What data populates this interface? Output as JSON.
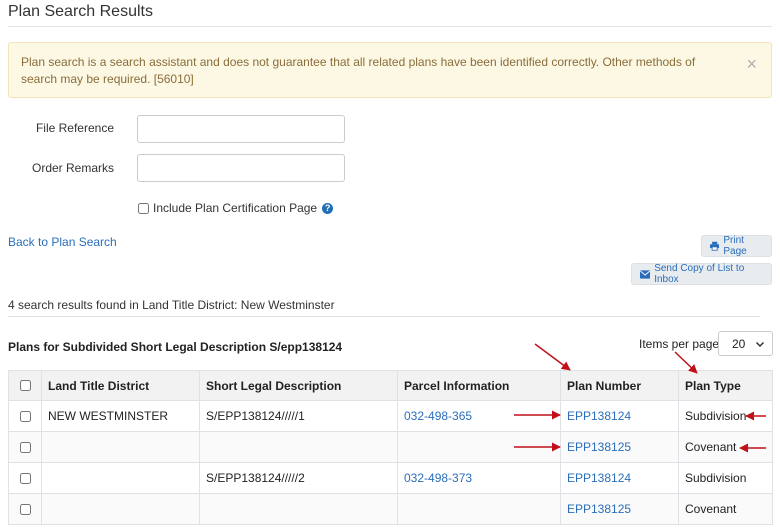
{
  "page": {
    "title": "Plan Search Results"
  },
  "alert": {
    "message": "Plan search is a search assistant and does not guarantee that all related plans have been identified correctly. Other methods of search may be required. [56010]",
    "close_symbol": "×"
  },
  "form": {
    "file_reference_label": "File Reference",
    "file_reference_value": "",
    "order_remarks_label": "Order Remarks",
    "order_remarks_value": "",
    "certification_label": "Include Plan Certification Page",
    "certification_checked": false
  },
  "actions": {
    "back_link": "Back to Plan Search",
    "print_label": "Print Page",
    "send_label": "Send Copy of List to Inbox"
  },
  "results": {
    "summary": "4 search results found in Land Title District: New Westminster",
    "table_title": "Plans for Subdivided Short Legal Description S/epp138124",
    "items_per_page_label": "Items per page",
    "items_per_page_value": "20",
    "columns": [
      "Land Title District",
      "Short Legal Description",
      "Parcel Information",
      "Plan Number",
      "Plan Type"
    ],
    "rows": [
      {
        "district": "NEW WESTMINSTER",
        "short_legal": "S/EPP138124/////1",
        "parcel": "032-498-365",
        "plan_number": "EPP138124",
        "plan_type": "Subdivision"
      },
      {
        "district": "",
        "short_legal": "",
        "parcel": "",
        "plan_number": "EPP138125",
        "plan_type": "Covenant"
      },
      {
        "district": "",
        "short_legal": "S/EPP138124/////2",
        "parcel": "032-498-373",
        "plan_number": "EPP138124",
        "plan_type": "Subdivision"
      },
      {
        "district": "",
        "short_legal": "",
        "parcel": "",
        "plan_number": "EPP138125",
        "plan_type": "Covenant"
      }
    ]
  },
  "colors": {
    "link": "#2a6ebb",
    "alert_bg": "#fcf8e3",
    "alert_text": "#8a6d3b",
    "annotation_arrow": "#c0101a"
  },
  "icons": [
    "close-icon",
    "help-icon",
    "printer-icon",
    "envelope-icon",
    "chevron-down-icon",
    "annotation-arrow-icon"
  ]
}
